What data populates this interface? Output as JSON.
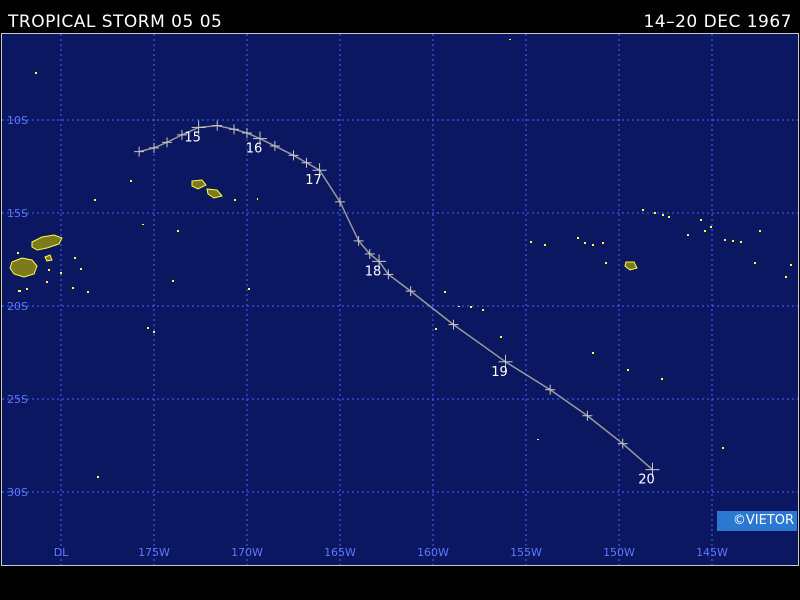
{
  "header": {
    "title": "TROPICAL STORM 05 05",
    "dates": "14–20 DEC 1967"
  },
  "map": {
    "background_color": "#0b1760",
    "grid_color": "#4a66ff",
    "track_color": "#9a9a9a",
    "land_color": "#7b7a1c",
    "land_outline_color": "#ffff40",
    "lat_labels": [
      {
        "lat": -10,
        "text": "10S"
      },
      {
        "lat": -15,
        "text": "15S"
      },
      {
        "lat": -20,
        "text": "20S"
      },
      {
        "lat": -25,
        "text": "25S"
      },
      {
        "lat": -30,
        "text": "30S"
      }
    ],
    "lon_labels": [
      {
        "lon": -180,
        "text": "DL"
      },
      {
        "lon": -175,
        "text": "175W"
      },
      {
        "lon": -170,
        "text": "170W"
      },
      {
        "lon": -165,
        "text": "165W"
      },
      {
        "lon": -160,
        "text": "160W"
      },
      {
        "lon": -155,
        "text": "155W"
      },
      {
        "lon": -150,
        "text": "150W"
      },
      {
        "lon": -145,
        "text": "145W"
      }
    ]
  },
  "storm_track": [
    {
      "lon": -175.8,
      "lat": -11.7
    },
    {
      "lon": -175.0,
      "lat": -11.5
    },
    {
      "lon": -174.3,
      "lat": -11.2
    },
    {
      "lon": -173.5,
      "lat": -10.8
    },
    {
      "lon": -172.6,
      "lat": -10.4,
      "day": "15"
    },
    {
      "lon": -171.6,
      "lat": -10.3
    },
    {
      "lon": -170.7,
      "lat": -10.5
    },
    {
      "lon": -170.0,
      "lat": -10.7
    },
    {
      "lon": -169.3,
      "lat": -11.0,
      "day": "16"
    },
    {
      "lon": -168.5,
      "lat": -11.4
    },
    {
      "lon": -167.5,
      "lat": -11.9
    },
    {
      "lon": -166.8,
      "lat": -12.3
    },
    {
      "lon": -166.1,
      "lat": -12.7,
      "day": "17"
    },
    {
      "lon": -165.0,
      "lat": -14.4
    },
    {
      "lon": -164.0,
      "lat": -16.5
    },
    {
      "lon": -163.4,
      "lat": -17.2
    },
    {
      "lon": -162.9,
      "lat": -17.6,
      "day": "18"
    },
    {
      "lon": -162.4,
      "lat": -18.3
    },
    {
      "lon": -161.2,
      "lat": -19.2
    },
    {
      "lon": -158.9,
      "lat": -21.0
    },
    {
      "lon": -156.1,
      "lat": -23.0,
      "day": "19"
    },
    {
      "lon": -153.7,
      "lat": -24.5
    },
    {
      "lon": -151.7,
      "lat": -25.9
    },
    {
      "lon": -149.8,
      "lat": -27.4
    },
    {
      "lon": -148.2,
      "lat": -28.8,
      "day": "20"
    }
  ],
  "credit": "©VIETOR"
}
